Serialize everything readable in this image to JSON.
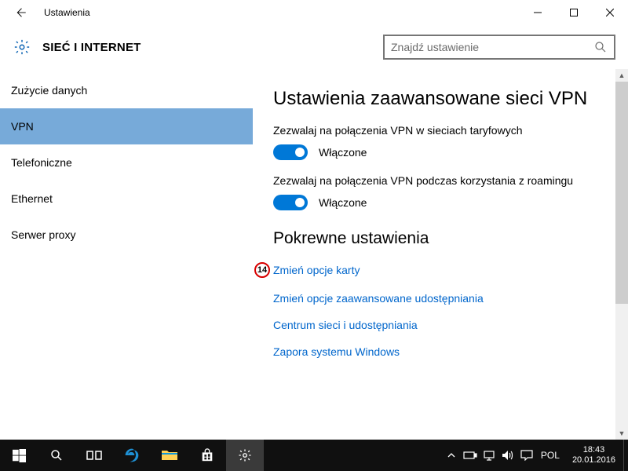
{
  "window": {
    "title": "Ustawienia"
  },
  "header": {
    "section": "SIEĆ I INTERNET",
    "search_placeholder": "Znajdź ustawienie"
  },
  "sidebar": {
    "items": [
      {
        "label": "Zużycie danych",
        "selected": false
      },
      {
        "label": "VPN",
        "selected": true
      },
      {
        "label": "Telefoniczne",
        "selected": false
      },
      {
        "label": "Ethernet",
        "selected": false
      },
      {
        "label": "Serwer proxy",
        "selected": false
      }
    ]
  },
  "content": {
    "heading": "Ustawienia zaawansowane sieci VPN",
    "settings": [
      {
        "label": "Zezwalaj na połączenia VPN w sieciach taryfowych",
        "state": "Włączone",
        "on": true
      },
      {
        "label": "Zezwalaj na połączenia VPN podczas korzystania z roamingu",
        "state": "Włączone",
        "on": true
      }
    ],
    "related_heading": "Pokrewne ustawienia",
    "links": [
      {
        "label": "Zmień opcje karty",
        "badge": "14"
      },
      {
        "label": "Zmień opcje zaawansowane udostępniania"
      },
      {
        "label": "Centrum sieci i udostępniania"
      },
      {
        "label": "Zapora systemu Windows"
      }
    ]
  },
  "taskbar": {
    "language": "POL",
    "time": "18:43",
    "date": "20.01.2016"
  },
  "colors": {
    "accent": "#0078d7",
    "link": "#0066cc",
    "sidebar_selected": "#77aad9",
    "badge_ring": "#d80000"
  }
}
